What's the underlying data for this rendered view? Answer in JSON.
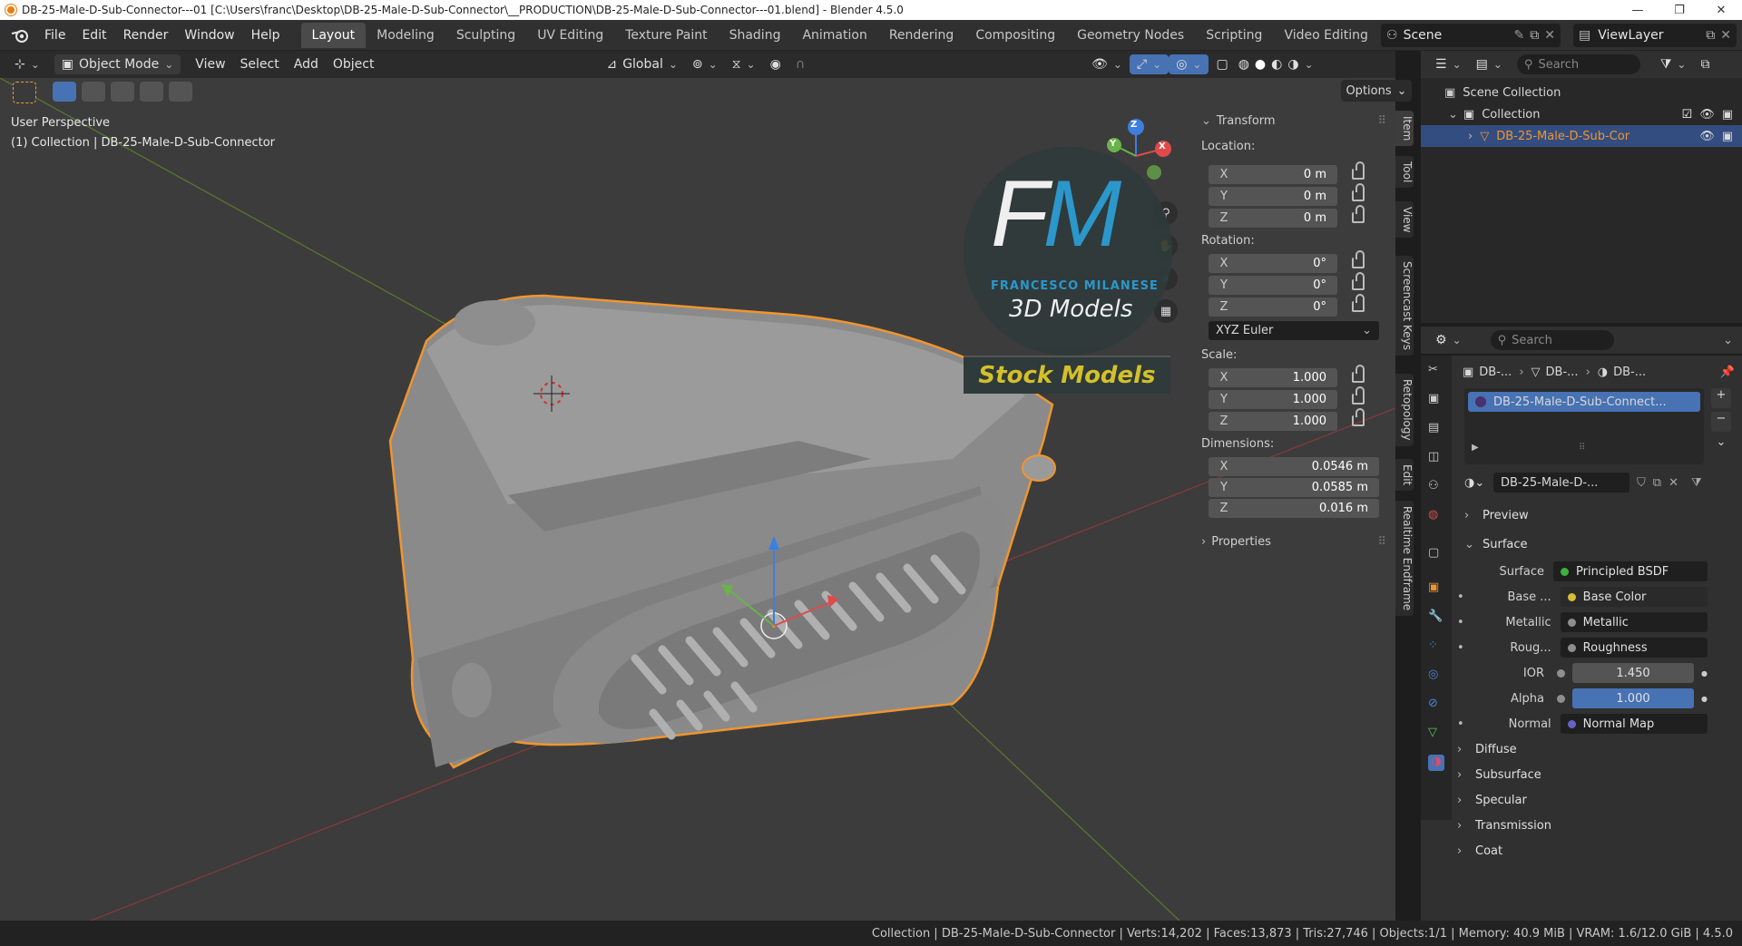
{
  "window": {
    "title": "DB-25-Male-D-Sub-Connector---01 [C:\\Users\\franc\\Desktop\\DB-25-Male-D-Sub-Connector\\__PRODUCTION\\DB-25-Male-D-Sub-Connector---01.blend] - Blender 4.5.0",
    "minimize": "—",
    "maximize": "❐",
    "close": "✕"
  },
  "menu": [
    "File",
    "Edit",
    "Render",
    "Window",
    "Help"
  ],
  "workspaces": [
    "Layout",
    "Modeling",
    "Sculpting",
    "UV Editing",
    "Texture Paint",
    "Shading",
    "Animation",
    "Rendering",
    "Compositing",
    "Geometry Nodes",
    "Scripting",
    "Video Editing"
  ],
  "active_workspace": "Layout",
  "scene": "Scene",
  "view_layer": "ViewLayer",
  "viewport_header": {
    "mode": "Object Mode",
    "menus": [
      "View",
      "Select",
      "Add",
      "Object"
    ],
    "orientation": "Global",
    "options": "Options"
  },
  "viewport": {
    "perspective": "User Perspective",
    "collection_line": "(1) Collection | DB-25-Male-D-Sub-Connector",
    "gizmo_axes": [
      "X",
      "Y",
      "Z"
    ],
    "logo": {
      "letters": "FM",
      "brand": "FRANCESCO MILANESE",
      "sub": "3D Models",
      "banner": "Stock Models"
    }
  },
  "npanel": {
    "tabs": [
      "Item",
      "Tool",
      "View",
      "Screencast Keys",
      "Retopology",
      "Edit",
      "Realtime Endframe"
    ],
    "transform_title": "Transform",
    "location_label": "Location:",
    "location": [
      [
        "X",
        "0 m"
      ],
      [
        "Y",
        "0 m"
      ],
      [
        "Z",
        "0 m"
      ]
    ],
    "rotation_label": "Rotation:",
    "rotation": [
      [
        "X",
        "0°"
      ],
      [
        "Y",
        "0°"
      ],
      [
        "Z",
        "0°"
      ]
    ],
    "rotation_mode": "XYZ Euler",
    "scale_label": "Scale:",
    "scale": [
      [
        "X",
        "1.000"
      ],
      [
        "Y",
        "1.000"
      ],
      [
        "Z",
        "1.000"
      ]
    ],
    "dimensions_label": "Dimensions:",
    "dimensions": [
      [
        "X",
        "0.0546 m"
      ],
      [
        "Y",
        "0.0585 m"
      ],
      [
        "Z",
        "0.016 m"
      ]
    ],
    "properties_title": "Properties"
  },
  "outliner": {
    "search_placeholder": "Search",
    "items": [
      "Scene Collection",
      "Collection",
      "DB-25-Male-D-Sub-Cor"
    ]
  },
  "properties": {
    "search_placeholder": "Search",
    "breadcrumb": [
      "DB-...",
      "DB-...",
      "DB-..."
    ],
    "material_slot": "DB-25-Male-D-Sub-Connect...",
    "material_name": "DB-25-Male-D-...",
    "preview": "Preview",
    "surface_section": "Surface",
    "rows": [
      {
        "key": "Surface",
        "val": "Principled BSDF",
        "dot": "#3db33d",
        "type": "link"
      },
      {
        "key": "Base ...",
        "val": "Base Color",
        "dot": "#d4c032",
        "type": "link"
      },
      {
        "key": "Metallic",
        "val": "Metallic",
        "dot": "#8e8e8e",
        "type": "link"
      },
      {
        "key": "Roug...",
        "val": "Roughness",
        "dot": "#8e8e8e",
        "type": "link"
      },
      {
        "key": "IOR",
        "val": "1.450",
        "dot": "#8e8e8e",
        "type": "num"
      },
      {
        "key": "Alpha",
        "val": "1.000",
        "dot": "#8e8e8e",
        "type": "blue"
      },
      {
        "key": "Normal",
        "val": "Normal Map",
        "dot": "#6363c7",
        "type": "link"
      }
    ],
    "subsections": [
      "Diffuse",
      "Subsurface",
      "Specular",
      "Transmission",
      "Coat"
    ]
  },
  "statusbar": "Collection | DB-25-Male-D-Sub-Connector | Verts:14,202 | Faces:13,873 | Tris:27,746 | Objects:1/1 | Memory: 40.9 MiB | VRAM: 1.6/12.0 GiB | 4.5.0",
  "colors": {
    "accent": "#4772b3",
    "selection_outline": "#f0952e",
    "logo_blue": "#2a9fd8",
    "banner_text": "#d4c02a"
  }
}
